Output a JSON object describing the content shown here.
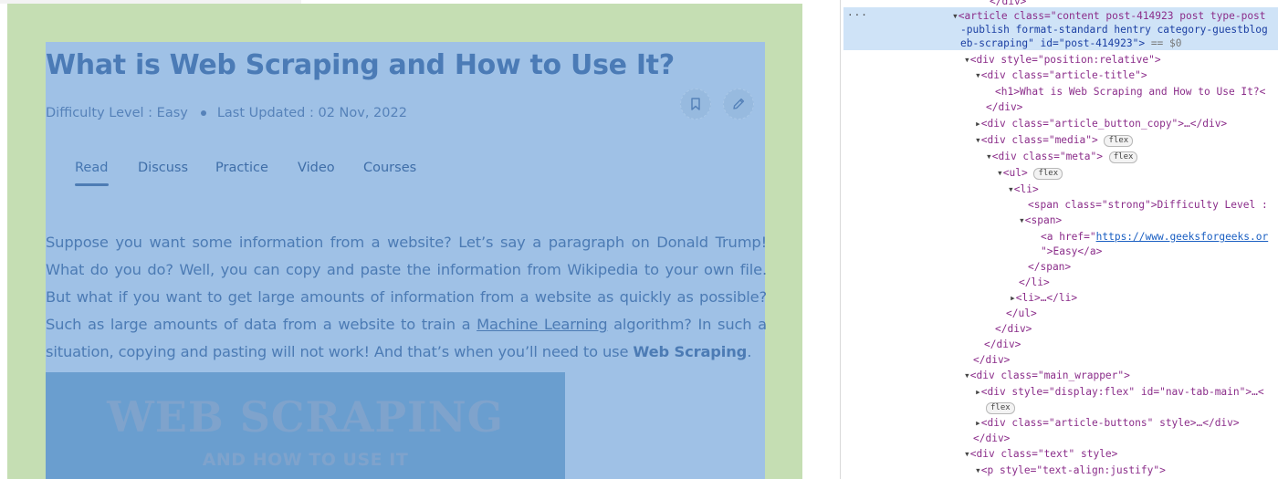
{
  "article": {
    "title": "What is Web Scraping and How to Use It?",
    "difficulty": "Difficulty Level : Easy",
    "updated": "Last Updated : 02 Nov, 2022",
    "tabs": [
      "Read",
      "Discuss",
      "Practice",
      "Video",
      "Courses"
    ],
    "paragraph_before_link": "Suppose you want some information from a website? Let’s say a paragraph on Donald Trump! What do you do? Well, you can copy and paste the information from Wikipedia to your own file. But what if you want to get large amounts of information from a website as quickly as possible? Such as large amounts of data from a website to train a ",
    "paragraph_link": "Machine Learning",
    "paragraph_after_link": " algorithm? In such a situation, copying and pasting will not work! And that’s when you’ll need to use ",
    "paragraph_bold": "Web Scraping",
    "paragraph_end": ".",
    "hero_title": "WEB SCRAPING",
    "hero_subtitle": "AND HOW TO USE IT"
  },
  "devtools": {
    "selected_dots": "···",
    "lines": {
      "l0": "</div>",
      "l1a": "<article class=\"content post-414923 post type-post",
      "l1b": "-publish format-standard hentry category-guestblog",
      "l1c": "eb-scraping\" id=\"post-414923\">",
      "l1d": " == $0",
      "l2": "<div style=\"position:relative\">",
      "l3": "<div class=\"article-title\">",
      "l4": "<h1>What is Web Scraping and How to Use It?<",
      "l5": "</div>",
      "l6": "<div class=\"article_button_copy\">…</div>",
      "l7": "<div class=\"media\">",
      "l8": "<div class=\"meta\">",
      "l9": "<ul>",
      "l10": "<li>",
      "l11": "<span class=\"strong\">Difficulty Level :",
      "l12": "<span>",
      "l13a": "<a href=\"",
      "l13b": "https://www.geeksforgeeks.or",
      "l14": "\">Easy</a>",
      "l15": "</span>",
      "l16": "</li>",
      "l17": "<li>…</li>",
      "l18": "</ul>",
      "l19": "</div>",
      "l20": "</div>",
      "l21": "</div>",
      "l22": "<div class=\"main_wrapper\">",
      "l23": "<div style=\"display:flex\" id=\"nav-tab-main\">…<",
      "l24": "<div class=\"article-buttons\" style>…</div>",
      "l25": "</div>",
      "l26": "<div class=\"text\" style>",
      "l27": "<p style=\"text-align:justify\">"
    },
    "badge_flex": "flex"
  }
}
